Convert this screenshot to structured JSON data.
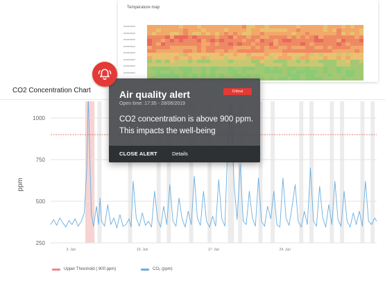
{
  "temperature_map": {
    "title": "Temperature map",
    "row_labels": [
      "##/##/####",
      "##/##/####",
      "##/##/####",
      "##/##/####",
      "##/##/####",
      "##/##/####",
      "##/##/####",
      "##/##/####",
      "##/##/####"
    ],
    "palette": [
      "#e8695f",
      "#ee8a63",
      "#f2a869",
      "#e9c170",
      "#c9c872",
      "#a3c873",
      "#8ccb76"
    ]
  },
  "co2_chart": {
    "title": "CO2 Concentration Chart",
    "legend": {
      "threshold_label": "Upper Threshold ( 900 ppm)",
      "series_label": "CO₂ (ppm)"
    }
  },
  "alert": {
    "title": "Air quality alert",
    "badge": "Critical",
    "open_time": "Open time: 17:35 - 28/06/2019",
    "message": "CO2 concentration is above 900 ppm. This impacts the well-being",
    "close_label": "CLOSE ALERT",
    "details_label": "Details"
  },
  "colors": {
    "alert_red": "#e53935",
    "series_blue": "#6aaee0",
    "threshold_red": "#d9534f",
    "band_grey": "#ececec"
  },
  "chart_data": {
    "type": "line",
    "ylabel": "ppm",
    "ylim": [
      250,
      1100
    ],
    "yticks": [
      250,
      500,
      750,
      1000
    ],
    "xlim": [
      0,
      32
    ],
    "xticks": [
      {
        "value": 2,
        "label": "3. Jun"
      },
      {
        "value": 9,
        "label": "10. Jun"
      },
      {
        "value": 16,
        "label": "17. Jun"
      },
      {
        "value": 23,
        "label": "24. Jun"
      }
    ],
    "threshold": 900,
    "highlight_band": [
      3.4,
      4.3
    ],
    "weekend_bands": [
      [
        3.4,
        4.3
      ],
      [
        4.6,
        5.0
      ],
      [
        7.6,
        8.0
      ],
      [
        10.4,
        10.8
      ],
      [
        11.4,
        11.8
      ],
      [
        13.6,
        14.0
      ],
      [
        15.4,
        15.8
      ],
      [
        17.4,
        18.0
      ],
      [
        18.4,
        18.8
      ],
      [
        20.4,
        20.8
      ],
      [
        21.6,
        22.0
      ],
      [
        24.4,
        24.8
      ],
      [
        25.4,
        25.8
      ],
      [
        27.4,
        27.8
      ],
      [
        28.4,
        28.8
      ],
      [
        30.4,
        30.8
      ],
      [
        31.4,
        31.8
      ]
    ],
    "series": [
      {
        "name": "CO₂ (ppm)",
        "x": [
          0,
          0.3,
          0.6,
          0.9,
          1.2,
          1.5,
          1.8,
          2.1,
          2.4,
          2.7,
          3.0,
          3.3,
          3.55,
          3.7,
          3.85,
          4.0,
          4.2,
          4.5,
          4.7,
          4.85,
          5.0,
          5.3,
          5.6,
          5.9,
          6.2,
          6.5,
          6.8,
          7.1,
          7.4,
          7.7,
          7.9,
          8.1,
          8.4,
          8.7,
          9.0,
          9.3,
          9.6,
          9.9,
          10.2,
          10.5,
          10.8,
          11.1,
          11.4,
          11.7,
          12.0,
          12.3,
          12.6,
          12.9,
          13.2,
          13.5,
          13.8,
          14.1,
          14.4,
          14.7,
          15.0,
          15.3,
          15.6,
          15.9,
          16.2,
          16.5,
          16.8,
          17.1,
          17.4,
          17.7,
          18.0,
          18.3,
          18.6,
          18.9,
          19.2,
          19.5,
          19.8,
          20.1,
          20.4,
          20.7,
          21.0,
          21.3,
          21.6,
          21.9,
          22.2,
          22.5,
          22.8,
          23.1,
          23.4,
          23.7,
          24.0,
          24.3,
          24.6,
          24.9,
          25.2,
          25.5,
          25.8,
          26.1,
          26.4,
          26.7,
          27.0,
          27.3,
          27.6,
          27.9,
          28.2,
          28.5,
          28.8,
          29.1,
          29.4,
          29.7,
          30.0,
          30.3,
          30.6,
          30.9,
          31.2,
          31.5,
          31.8,
          32.0
        ],
        "values": [
          360,
          390,
          355,
          400,
          370,
          345,
          385,
          360,
          395,
          350,
          380,
          430,
          700,
          1130,
          760,
          420,
          350,
          470,
          360,
          520,
          380,
          350,
          480,
          360,
          400,
          340,
          420,
          350,
          360,
          395,
          345,
          620,
          400,
          350,
          430,
          355,
          380,
          345,
          560,
          390,
          345,
          470,
          360,
          600,
          380,
          350,
          520,
          395,
          345,
          440,
          360,
          650,
          400,
          355,
          560,
          380,
          345,
          410,
          350,
          630,
          395,
          350,
          880,
          1080,
          600,
          390,
          720,
          380,
          360,
          560,
          400,
          350,
          640,
          380,
          350,
          470,
          395,
          560,
          360,
          345,
          640,
          400,
          355,
          470,
          600,
          380,
          345,
          440,
          360,
          700,
          380,
          350,
          590,
          400,
          345,
          480,
          360,
          620,
          390,
          350,
          560,
          380,
          345,
          430,
          360,
          440,
          350,
          620,
          380,
          360,
          400,
          380
        ]
      }
    ]
  }
}
